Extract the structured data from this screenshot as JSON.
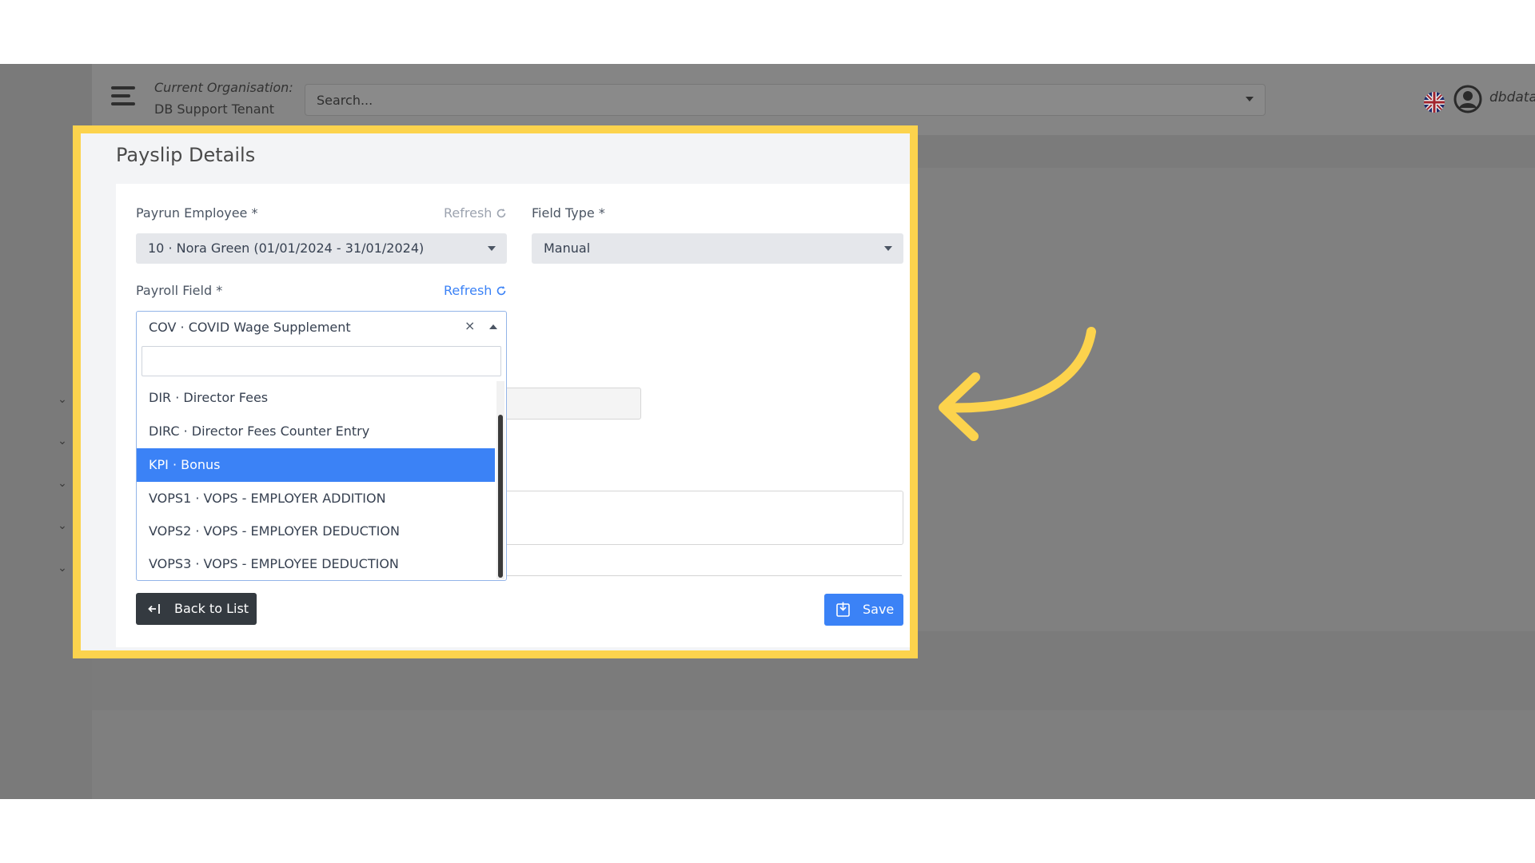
{
  "header": {
    "org_label": "Current Organisation:",
    "org_name": "DB Support Tenant",
    "search_placeholder": "Search...",
    "user_name": "dbdata",
    "language_icon": "uk-flag-icon",
    "avatar_icon": "user-circle-icon"
  },
  "page": {
    "title": "Payslip Details"
  },
  "form": {
    "payrun_employee": {
      "label": "Payrun Employee  *",
      "refresh_label": "Refresh",
      "value": "10 · Nora Green (01/01/2024 - 31/01/2024)"
    },
    "field_type": {
      "label": "Field Type *",
      "value": "Manual"
    },
    "payroll_field": {
      "label": "Payroll Field *",
      "refresh_label": "Refresh",
      "selected_value": "COV · COVID Wage Supplement",
      "clear_glyph": "×",
      "search_value": "",
      "options": [
        {
          "label": "DIR · Director Fees",
          "highlighted": false
        },
        {
          "label": "DIRC · Director Fees Counter Entry",
          "highlighted": false
        },
        {
          "label": "KPI · Bonus",
          "highlighted": true
        },
        {
          "label": "VOPS1 · VOPS - EMPLOYER ADDITION",
          "highlighted": false
        },
        {
          "label": "VOPS2 · VOPS - EMPLOYER DEDUCTION",
          "highlighted": false
        },
        {
          "label": "VOPS3 · VOPS - EMPLOYEE DEDUCTION",
          "highlighted": false
        }
      ]
    }
  },
  "buttons": {
    "back_label": "Back to List",
    "save_label": "Save"
  },
  "colors": {
    "highlight": "#fcd34d",
    "primary": "#3b82f6",
    "dark_button": "#343a40",
    "refresh_active": "#3b82f6",
    "refresh_muted": "#9ca3af"
  }
}
